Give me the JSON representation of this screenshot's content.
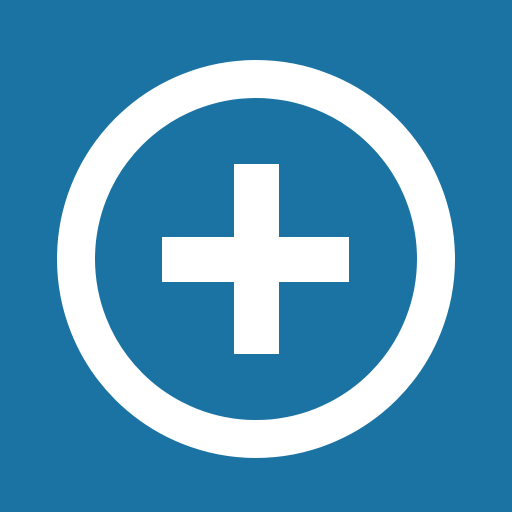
{
  "app_icon": {
    "semantic_name": "add-circle-icon",
    "background_color": "#1b73a3",
    "foreground_color": "#ffffff"
  }
}
